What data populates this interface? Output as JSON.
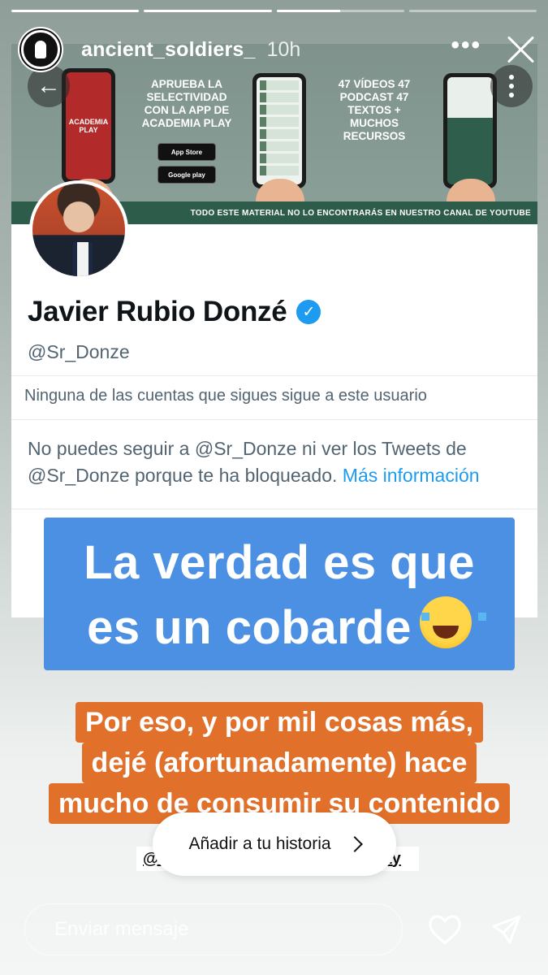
{
  "story": {
    "progress": [
      1,
      1,
      0.5,
      0
    ],
    "username": "ancient_soldiers_",
    "time": "10h",
    "more_label": "•••"
  },
  "banner": {
    "promo_left": "APRUEBA LA SELECTIVIDAD CON LA APP DE ACADEMIA PLAY",
    "promo_right": "47 VÍDEOS 47 PODCAST 47 TEXTOS + MUCHOS RECURSOS",
    "app_name": "ACADEMIA PLAY",
    "app_store": "App Store",
    "google_play": "Google play",
    "strip": "TODO ESTE MATERIAL NO LO ENCONTRARÁS EN NUESTRO CANAL DE YOUTUBE"
  },
  "profile": {
    "name": "Javier Rubio Donzé",
    "handle": "@Sr_Donze",
    "followers_note": "Ninguna de las cuentas que sigues sigue a este usuario",
    "blocked_text": "No puedes seguir a @Sr_Donze ni ver los Tweets de @Sr_Donze porque te ha bloqueado.",
    "more_info": "Más información"
  },
  "stickers": {
    "blue_line1": "La verdad es que",
    "blue_line2": "es un cobarde",
    "orange_line1": "Por eso, y por mil cosas más,",
    "orange_line2": "dejé (afortunadamente) hace",
    "orange_line3": "mucho de consumir su contenido",
    "tag_left": "@J",
    "tag_right": "lay"
  },
  "add_story": {
    "label": "Añadir a tu historia"
  },
  "message": {
    "placeholder": "Enviar mensaje"
  }
}
